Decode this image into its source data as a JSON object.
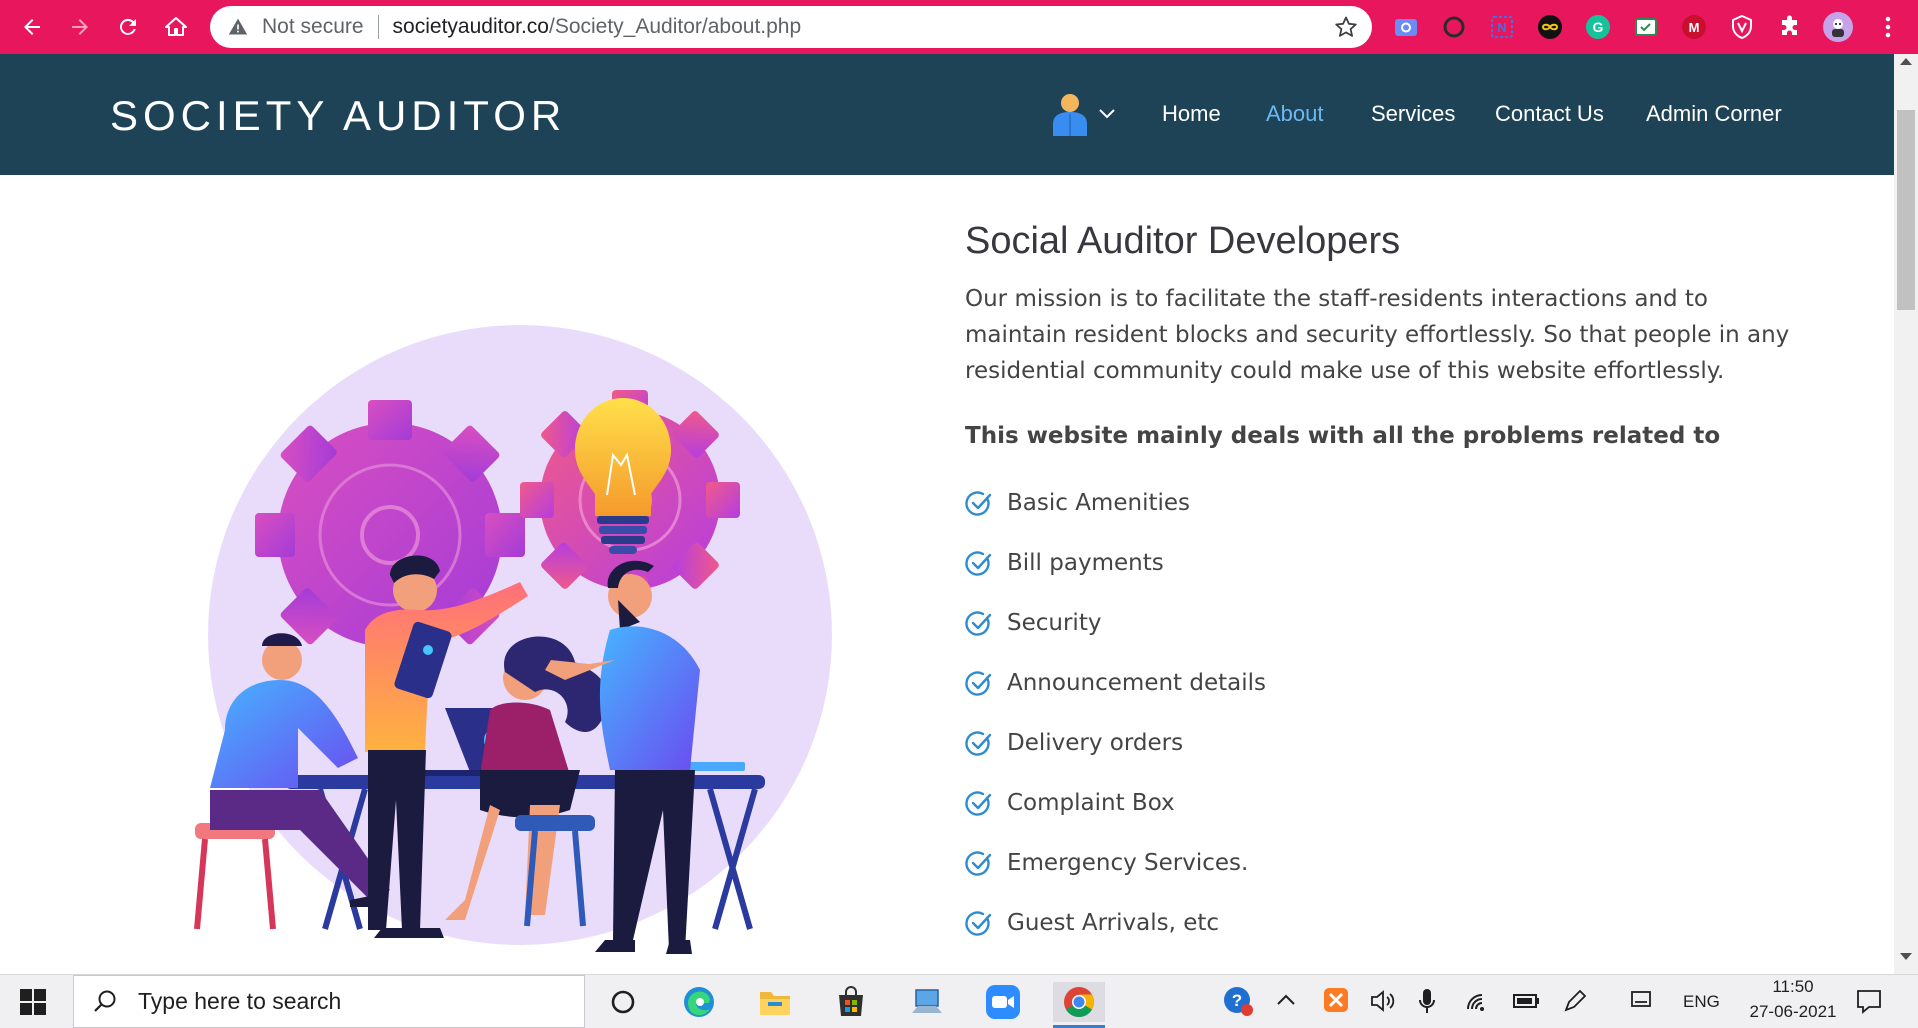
{
  "browser": {
    "security_status": "Not secure",
    "url_host": "societyauditor.co",
    "url_path": "/Society_Auditor/about.php",
    "extensions": [
      "camera-extension-icon",
      "circle-extension-icon",
      "note-extension-icon",
      "infinity-extension-icon",
      "grammarly-icon",
      "checklist-extension-icon",
      "mcafee-icon",
      "shield-extension-icon",
      "puzzle-icon",
      "profile-avatar-icon"
    ]
  },
  "site": {
    "logo": "SOCIETY AUDITOR",
    "nav": {
      "home": "Home",
      "about": "About",
      "services": "Services",
      "contact": "Contact Us",
      "admin": "Admin Corner"
    },
    "active_nav": "About",
    "accent_color": "#6bb9f0",
    "header_color": "#1e4356"
  },
  "about": {
    "title": "Social Auditor Developers",
    "mission": "Our mission is to facilitate the staff-residents interactions and to maintain resident blocks and security effortlessly. So that people in any residential community could make use of this website effortlessly.",
    "deals_heading": "This website mainly deals with all the problems related to",
    "features": [
      "Basic Amenities",
      "Bill payments",
      "Security",
      "Announcement details",
      "Delivery orders",
      "Complaint Box",
      "Emergency Services.",
      "Guest Arrivals, etc"
    ]
  },
  "taskbar": {
    "search_placeholder": "Type here to search",
    "language": "ENG",
    "time": "11:50",
    "date": "27-06-2021"
  }
}
